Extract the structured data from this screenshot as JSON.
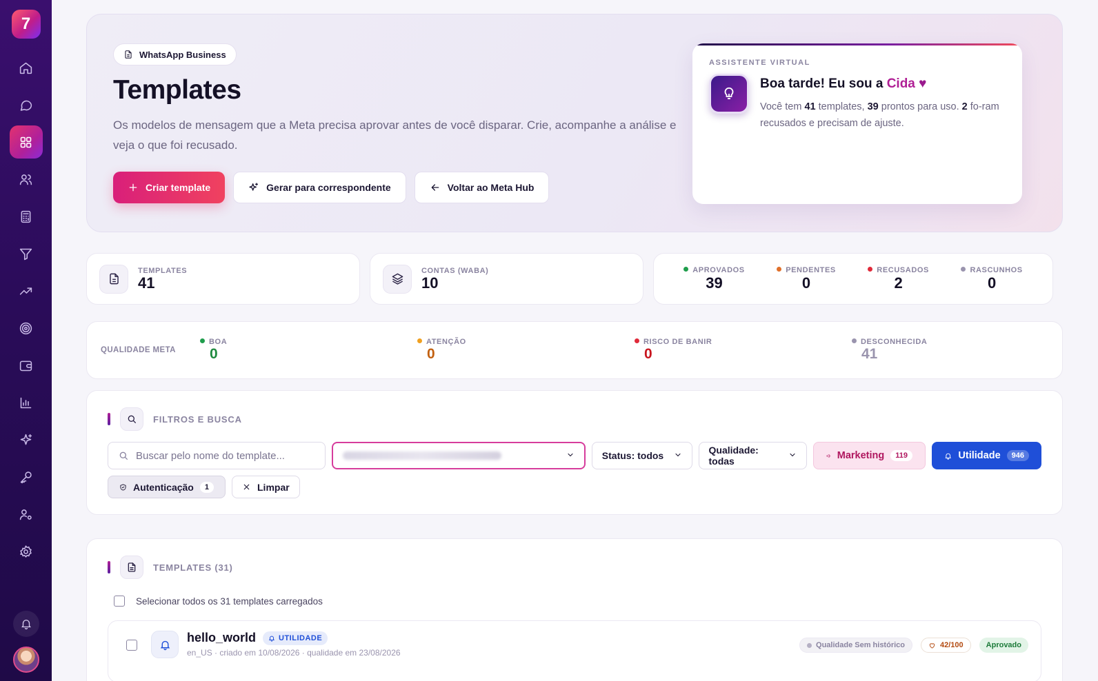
{
  "app": {
    "logo_text": "7"
  },
  "sidebar": {
    "items": [
      {
        "icon": "home-icon"
      },
      {
        "icon": "chat-icon"
      },
      {
        "icon": "grid-icon",
        "active": true
      },
      {
        "icon": "users-icon"
      },
      {
        "icon": "calculator-icon"
      },
      {
        "icon": "filter-icon"
      },
      {
        "icon": "trending-up-icon"
      },
      {
        "icon": "target-icon"
      },
      {
        "icon": "wallet-icon"
      },
      {
        "icon": "bar-chart-icon"
      },
      {
        "icon": "sparkles-icon"
      },
      {
        "icon": "key-icon"
      },
      {
        "icon": "user-settings-icon"
      },
      {
        "icon": "gear-icon"
      }
    ]
  },
  "hero": {
    "chip": "WhatsApp Business",
    "title": "Templates",
    "description": "Os modelos de mensagem que a Meta precisa aprovar antes de você disparar. Crie, acompanhe a análise e veja o que foi recusado.",
    "buttons": {
      "create": "Criar template",
      "generate": "Gerar para correspondente",
      "back": "Voltar ao Meta Hub"
    }
  },
  "assistant": {
    "label": "ASSISTENTE VIRTUAL",
    "greeting_prefix": "Boa tarde! Eu sou a",
    "name": "Cida",
    "heart": "♥",
    "text_1": "Você tem",
    "total": "41",
    "text_2": "templates,",
    "ready": "39",
    "text_3": "prontos para uso.",
    "rejected": "2",
    "text_4": "fo-ram recusados e precisam de ajuste."
  },
  "stats": {
    "templates": {
      "label": "TEMPLATES",
      "value": "41"
    },
    "accounts": {
      "label": "CONTAS (WABA)",
      "value": "10"
    },
    "status": [
      {
        "label": "APROVADOS",
        "value": "39",
        "color": "#1f9d4c"
      },
      {
        "label": "PENDENTES",
        "value": "0",
        "color": "#e0702a"
      },
      {
        "label": "RECUSADOS",
        "value": "2",
        "color": "#e02a3a"
      },
      {
        "label": "RASCUNHOS",
        "value": "0",
        "color": "#9a94ae"
      }
    ]
  },
  "quality": {
    "title": "QUALIDADE META",
    "items": [
      {
        "label": "BOA",
        "value": "0",
        "dot": "#1f9d4c",
        "color": "#1f8a3f"
      },
      {
        "label": "ATENÇÃO",
        "value": "0",
        "dot": "#f0a020",
        "color": "#c26010"
      },
      {
        "label": "RISCO DE BANIR",
        "value": "0",
        "dot": "#e02a3a",
        "color": "#c8161f"
      },
      {
        "label": "DESCONHECIDA",
        "value": "41",
        "dot": "#9a94ae",
        "color": "#9a94ae"
      }
    ]
  },
  "filters": {
    "title": "FILTROS E BUSCA",
    "search_placeholder": "Buscar pelo nome do template...",
    "status_select": "Status: todos",
    "quality_select": "Qualidade: todas",
    "marketing": {
      "label": "Marketing",
      "count": "119"
    },
    "utilidade": {
      "label": "Utilidade",
      "count": "946"
    },
    "autenticacao": {
      "label": "Autenticação",
      "count": "1"
    },
    "clear": "Limpar"
  },
  "templates": {
    "title": "TEMPLATES (31)",
    "select_all": "Selecionar todos os 31 templates carregados",
    "rows": [
      {
        "name": "hello_world",
        "category": "UTILIDADE",
        "meta": "en_US · criado em 10/08/2026 · qualidade em 23/08/2026",
        "quality_tag": "Qualidade Sem histórico",
        "score": "42/100",
        "status": "Aprovado"
      }
    ]
  }
}
